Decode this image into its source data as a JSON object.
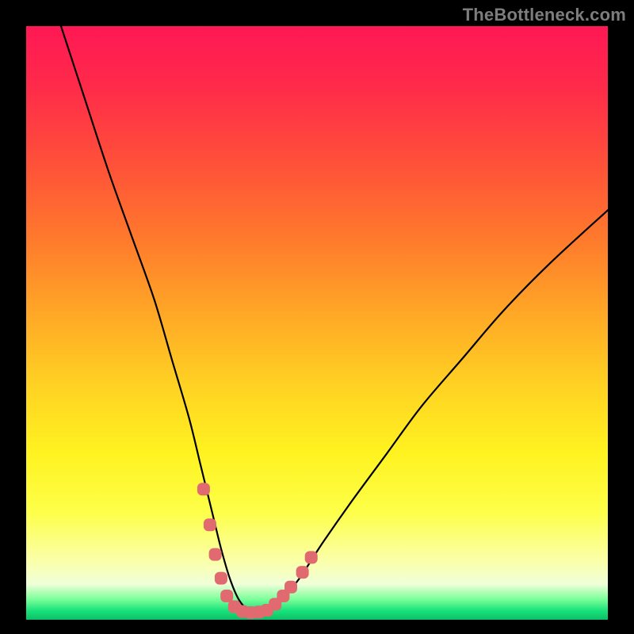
{
  "watermark": "TheBottleneck.com",
  "colors": {
    "frame": "#000000",
    "curve_stroke": "#000000",
    "marker_fill": "#e06a6f",
    "marker_stroke": "#e06a6f"
  },
  "chart_data": {
    "type": "line",
    "title": "",
    "xlabel": "",
    "ylabel": "",
    "xlim": [
      0,
      100
    ],
    "ylim": [
      0,
      100
    ],
    "grid": false,
    "series": [
      {
        "name": "bottleneck-curve",
        "x": [
          6,
          10,
          14,
          18,
          22,
          25,
          28,
          30,
          32,
          33.5,
          35,
          36.5,
          38,
          40,
          42,
          44,
          47,
          51,
          56,
          62,
          68,
          75,
          82,
          90,
          100
        ],
        "values": [
          100,
          88,
          76,
          65,
          54,
          44,
          34,
          26,
          18,
          12,
          7,
          3.5,
          1.8,
          1.2,
          1.8,
          3.5,
          7,
          13,
          20,
          28,
          36,
          44,
          52,
          60,
          69
        ]
      }
    ],
    "markers": [
      {
        "x": 30.5,
        "y": 22
      },
      {
        "x": 31.6,
        "y": 16
      },
      {
        "x": 32.5,
        "y": 11
      },
      {
        "x": 33.5,
        "y": 7
      },
      {
        "x": 34.5,
        "y": 4
      },
      {
        "x": 35.8,
        "y": 2.2
      },
      {
        "x": 37.2,
        "y": 1.4
      },
      {
        "x": 38.6,
        "y": 1.2
      },
      {
        "x": 40.0,
        "y": 1.3
      },
      {
        "x": 41.4,
        "y": 1.6
      },
      {
        "x": 42.8,
        "y": 2.6
      },
      {
        "x": 44.2,
        "y": 4
      },
      {
        "x": 45.5,
        "y": 5.5
      },
      {
        "x": 47.5,
        "y": 8
      },
      {
        "x": 49.0,
        "y": 10.5
      }
    ]
  }
}
